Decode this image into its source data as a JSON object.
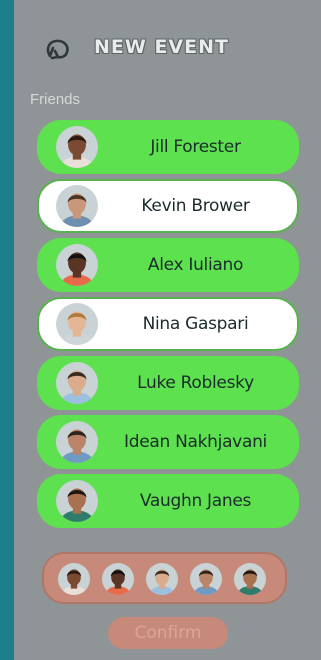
{
  "header": {
    "title": "NEW EVENT",
    "back_icon": "back-arrow-icon"
  },
  "friends_section": {
    "label": "Friends"
  },
  "friends": [
    {
      "name": "Jill Forester",
      "selected": true,
      "skin": "#7a4a32",
      "hair": "#2b1a12",
      "shirt": "#e8e0d8"
    },
    {
      "name": "Kevin Brower",
      "selected": false,
      "skin": "#c9987a",
      "hair": "#4a3526",
      "shirt": "#6f8fb0"
    },
    {
      "name": "Alex Iuliano",
      "selected": true,
      "skin": "#5a3424",
      "hair": "#111111",
      "shirt": "#e56b4a"
    },
    {
      "name": "Nina Gaspari",
      "selected": false,
      "skin": "#e4b694",
      "hair": "#b27a3e",
      "shirt": "#cfd6d9"
    },
    {
      "name": "Luke Roblesky",
      "selected": true,
      "skin": "#d8ac8c",
      "hair": "#3b2a20",
      "shirt": "#9cc0e0"
    },
    {
      "name": "Idean Nakhjavani",
      "selected": true,
      "skin": "#b98468",
      "hair": "#2f241d",
      "shirt": "#6f9ac4"
    },
    {
      "name": "Vaughn Janes",
      "selected": true,
      "skin": "#a8714f",
      "hair": "#1f1712",
      "shirt": "#2f7c6a"
    }
  ],
  "selected_tray": {
    "avatars": [
      {
        "skin": "#7a4a32",
        "hair": "#2b1a12",
        "shirt": "#e8e0d8"
      },
      {
        "skin": "#5a3424",
        "hair": "#111111",
        "shirt": "#e56b4a"
      },
      {
        "skin": "#d8ac8c",
        "hair": "#3b2a20",
        "shirt": "#9cc0e0"
      },
      {
        "skin": "#b98468",
        "hair": "#2f241d",
        "shirt": "#6f9ac4"
      },
      {
        "skin": "#a8714f",
        "hair": "#1f1712",
        "shirt": "#2f7c6a"
      }
    ]
  },
  "actions": {
    "confirm_label": "Confirm"
  },
  "colors": {
    "selected_fill": "#5de14e",
    "unselected_fill": "#ffffff",
    "panel": "#8f9596",
    "accent_muted": "#c6897a"
  }
}
